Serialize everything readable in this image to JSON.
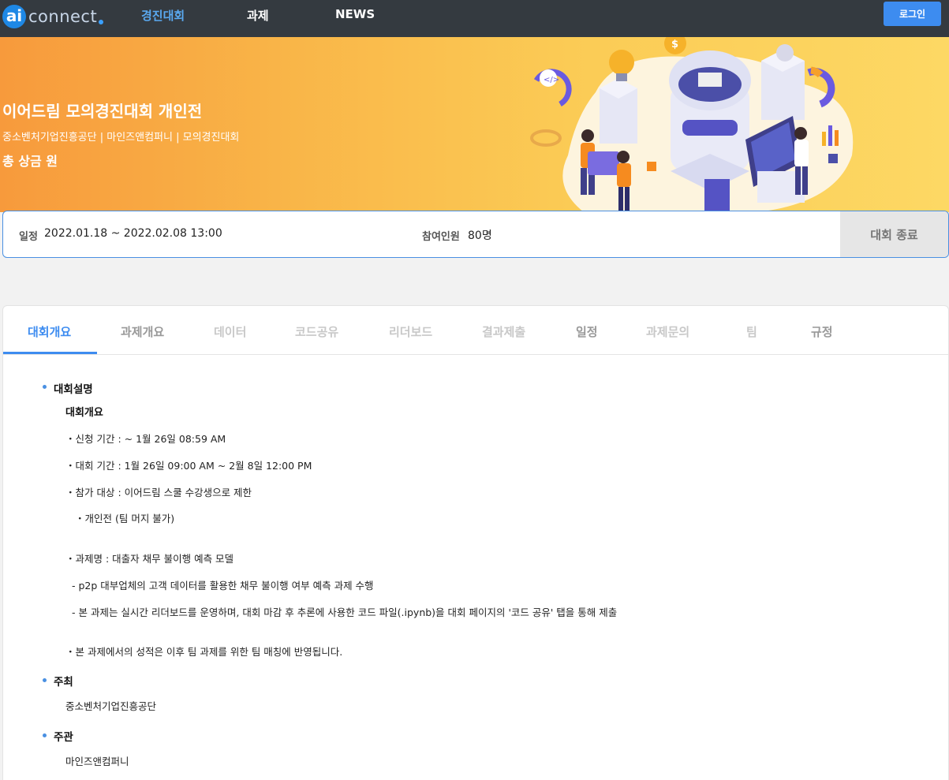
{
  "nav": {
    "logo_ai": "ai",
    "logo_text": "connect",
    "links": [
      "경진대회",
      "과제",
      "NEWS"
    ],
    "login": "로그인"
  },
  "hero": {
    "title": "이어드림 모의경진대회 개인전",
    "subtitle": "중소벤처기업진흥공단 | 마인즈앤컴퍼니 | 모의경진대회",
    "prize": "총 상금 원"
  },
  "info": {
    "schedule_label": "일정",
    "schedule_value": "2022.01.18 ~ 2022.02.08 13:00",
    "participants_label": "참여인원",
    "participants_value": "80명",
    "status_button": "대회 종료"
  },
  "tabs": [
    "대회개요",
    "과제개요",
    "데이터",
    "코드공유",
    "리더보드",
    "결과제출",
    "일정",
    "과제문의",
    "팀",
    "규정"
  ],
  "content": {
    "section1_title": "대회설명",
    "section1_subtitle": "대회개요",
    "lines": [
      "・신청 기간 : ~ 1월 26일 08:59 AM",
      "・대회 기간 : 1월 26일 09:00 AM ~ 2월 8일 12:00 PM",
      "・참가 대상 : 이어드림 스쿨 수강생으로 제한",
      "・개인전 (팀 머지 불가)",
      "・과제명 : 대출자 채무 불이행 예측 모델",
      "- p2p 대부업체의 고객 데이터를 활용한 채무 불이행 여부 예측 과제 수행",
      "- 본 과제는 실시간 리더보드를 운영하며, 대회 마감 후 추론에 사용한 코드 파일(.ipynb)을 대회 페이지의 '코드 공유' 탭을 통해 제출",
      "・본 과제에서의 성적은 이후 팀 과제를 위한 팀 매칭에 반영됩니다."
    ],
    "section2_title": "주최",
    "section2_value": "중소벤처기업진흥공단",
    "section3_title": "주관",
    "section3_value": "마인즈앤컴퍼니"
  }
}
